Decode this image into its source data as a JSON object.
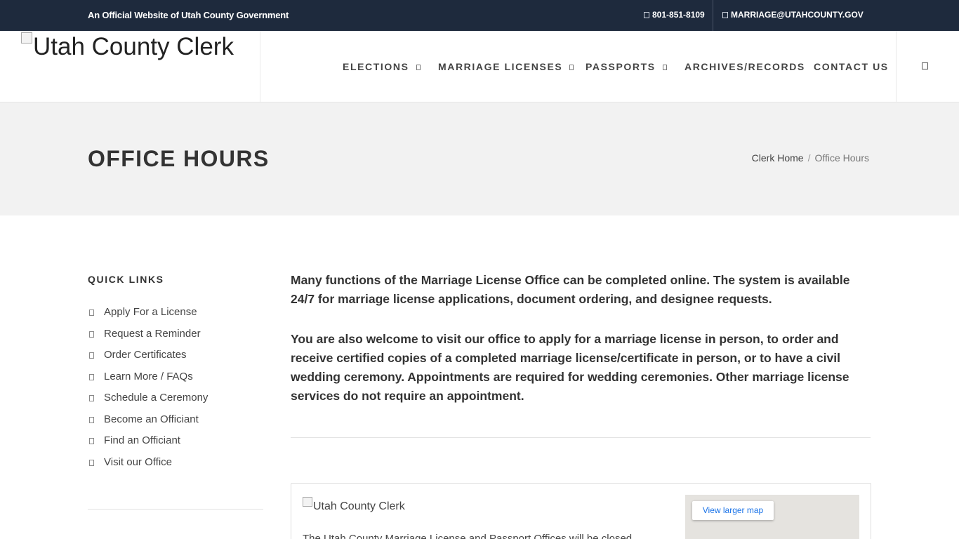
{
  "topbar": {
    "official_text": "An Official Website of Utah County Government",
    "phone": "801-851-8109",
    "phone_icon": "phone-icon",
    "email": "MARRIAGE@UTAHCOUNTY.GOV",
    "email_icon": "envelope-icon"
  },
  "header": {
    "logo_alt": "Utah County Clerk",
    "nav": [
      {
        "label": "ELECTIONS",
        "has_dropdown": true
      },
      {
        "label": "MARRIAGE LICENSES",
        "has_dropdown": true
      },
      {
        "label": "PASSPORTS",
        "has_dropdown": true
      },
      {
        "label": "ARCHIVES/RECORDS",
        "has_dropdown": false
      },
      {
        "label": "CONTACT US",
        "has_dropdown": false
      }
    ],
    "search_icon": "search-icon"
  },
  "page": {
    "title": "OFFICE HOURS",
    "breadcrumb": {
      "home": "Clerk Home",
      "separator": "/",
      "current": "Office Hours"
    }
  },
  "sidebar": {
    "title": "QUICK LINKS",
    "links": [
      "Apply For a License",
      "Request a Reminder",
      "Order Certificates",
      "Learn More / FAQs",
      "Schedule a Ceremony",
      "Become an Officiant",
      "Find an Officiant",
      "Visit our Office"
    ]
  },
  "main": {
    "paragraph1": "Many functions of the Marriage License Office can be completed online. The system is available 24/7 for marriage license applications, document ordering, and designee requests.",
    "paragraph2": "You are also welcome to visit our office to apply for a marriage license in person, to order and receive certified copies of a completed marriage license/certificate in person, or to have a civil wedding ceremony. Appointments are required for wedding ceremonies. Other marriage license services do not require an appointment.",
    "card": {
      "image_alt": "Utah County Clerk",
      "text": "The Utah County Marriage License and Passport Offices will be closed",
      "map_button": "View larger map"
    }
  },
  "colors": {
    "topbar_bg": "#1e2a3d",
    "band_bg": "#f2f2f2",
    "map_link": "#1a73e8"
  }
}
